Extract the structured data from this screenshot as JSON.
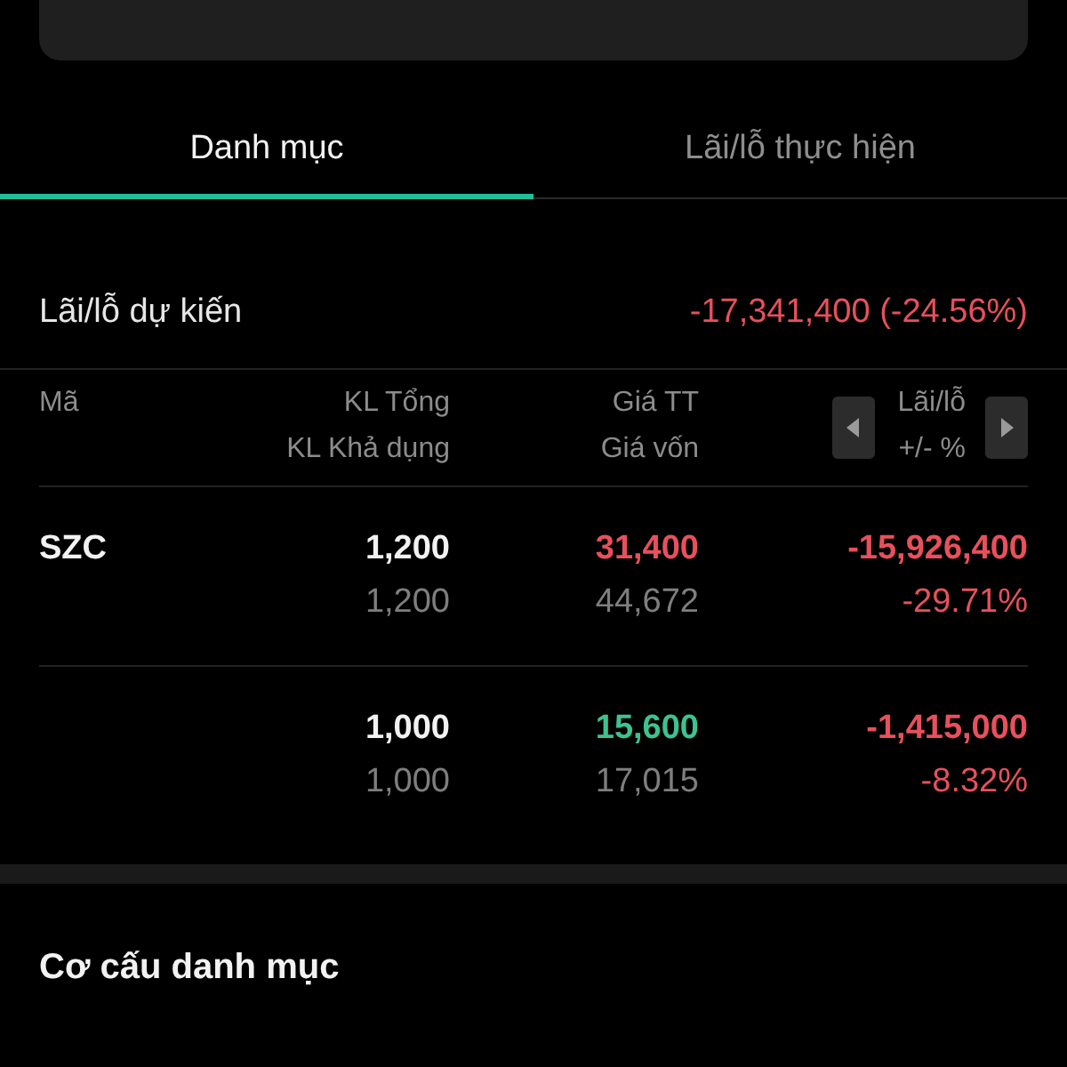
{
  "tabs": [
    {
      "label": "Danh mục",
      "selected": true
    },
    {
      "label": "Lãi/lỗ thực hiện",
      "selected": false
    }
  ],
  "summary": {
    "label": "Lãi/lỗ dự kiến",
    "value": "-17,341,400 (-24.56%)",
    "loss": true
  },
  "table": {
    "columns": [
      {
        "top": "Mã"
      },
      {
        "top": "KL Tổng",
        "bottom": "KL Khả dụng"
      },
      {
        "top": "Giá TT",
        "bottom": "Giá vốn"
      },
      {
        "top": "Lãi/lỗ",
        "bottom": "+/- %"
      }
    ],
    "rows": [
      {
        "symbol": "SZC",
        "total_qty": "1,200",
        "available_qty": "1,200",
        "market_price": "31,400",
        "price_up": false,
        "cost_price": "44,672",
        "pnl": "-15,926,400",
        "pnl_percent": "-29.71%",
        "loss": true
      },
      {
        "total_qty": "1,000",
        "available_qty": "1,000",
        "market_price": "15,600",
        "price_up": true,
        "cost_price": "17,015",
        "pnl": "-1,415,000",
        "pnl_percent": "-8.32%",
        "loss": true
      }
    ]
  },
  "section_title": "Cơ cấu danh mục"
}
